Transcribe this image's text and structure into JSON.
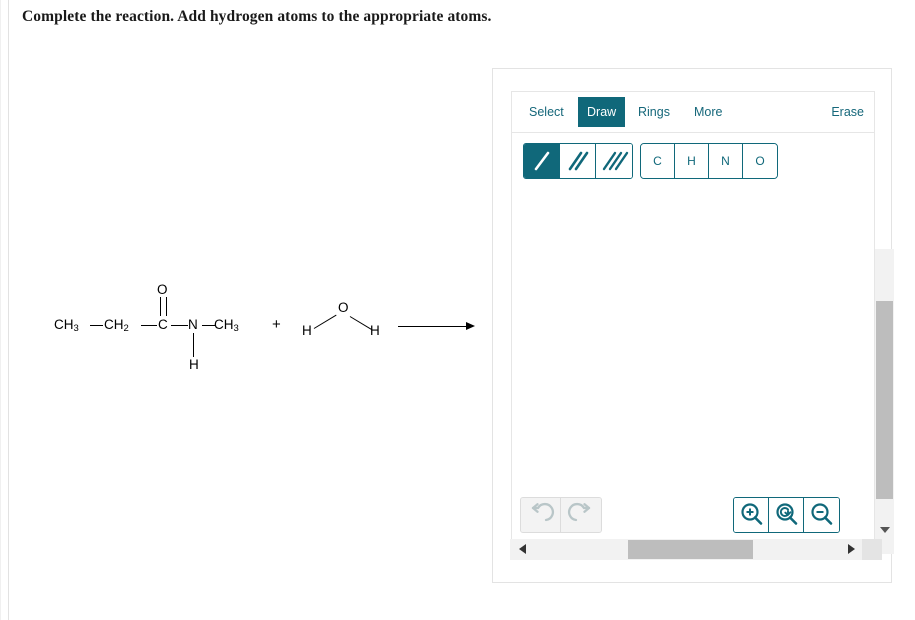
{
  "prompt": "Complete the reaction. Add hydrogen atoms to the appropriate atoms.",
  "colors": {
    "accent": "#10687a",
    "accent_text": "#15677a",
    "panel_border": "#e3e3e3",
    "scrollbar_thumb": "#bdbdbd",
    "disabled": "#b9c6c8"
  },
  "reaction": {
    "reactant1": {
      "name": "N-methylpropanamide",
      "labels": {
        "ch3_left": "CH3",
        "ch2": "CH2",
        "carbonyl_c": "C",
        "carbonyl_o": "O",
        "nitrogen": "N",
        "n_hydrogen": "H",
        "ch3_right": "CH3"
      }
    },
    "plus": "+",
    "reactant2": {
      "name": "water",
      "labels": {
        "h_left": "H",
        "oxygen": "O",
        "h_right": "H"
      }
    },
    "arrow": "reaction-arrow"
  },
  "editor": {
    "tabs": [
      {
        "label": "Select",
        "active": false
      },
      {
        "label": "Draw",
        "active": true
      },
      {
        "label": "Rings",
        "active": false
      },
      {
        "label": "More",
        "active": false
      }
    ],
    "erase_label": "Erase",
    "bond_tools": [
      {
        "name": "single-bond",
        "active": true
      },
      {
        "name": "double-bond",
        "active": false
      },
      {
        "name": "triple-bond",
        "active": false
      }
    ],
    "elements": [
      {
        "label": "C"
      },
      {
        "label": "H"
      },
      {
        "label": "N"
      },
      {
        "label": "O"
      }
    ],
    "history_buttons": [
      {
        "name": "undo-icon",
        "enabled": false
      },
      {
        "name": "redo-icon",
        "enabled": false
      }
    ],
    "zoom_buttons": [
      {
        "name": "zoom-in-icon"
      },
      {
        "name": "zoom-reset-icon"
      },
      {
        "name": "zoom-out-icon"
      }
    ]
  }
}
